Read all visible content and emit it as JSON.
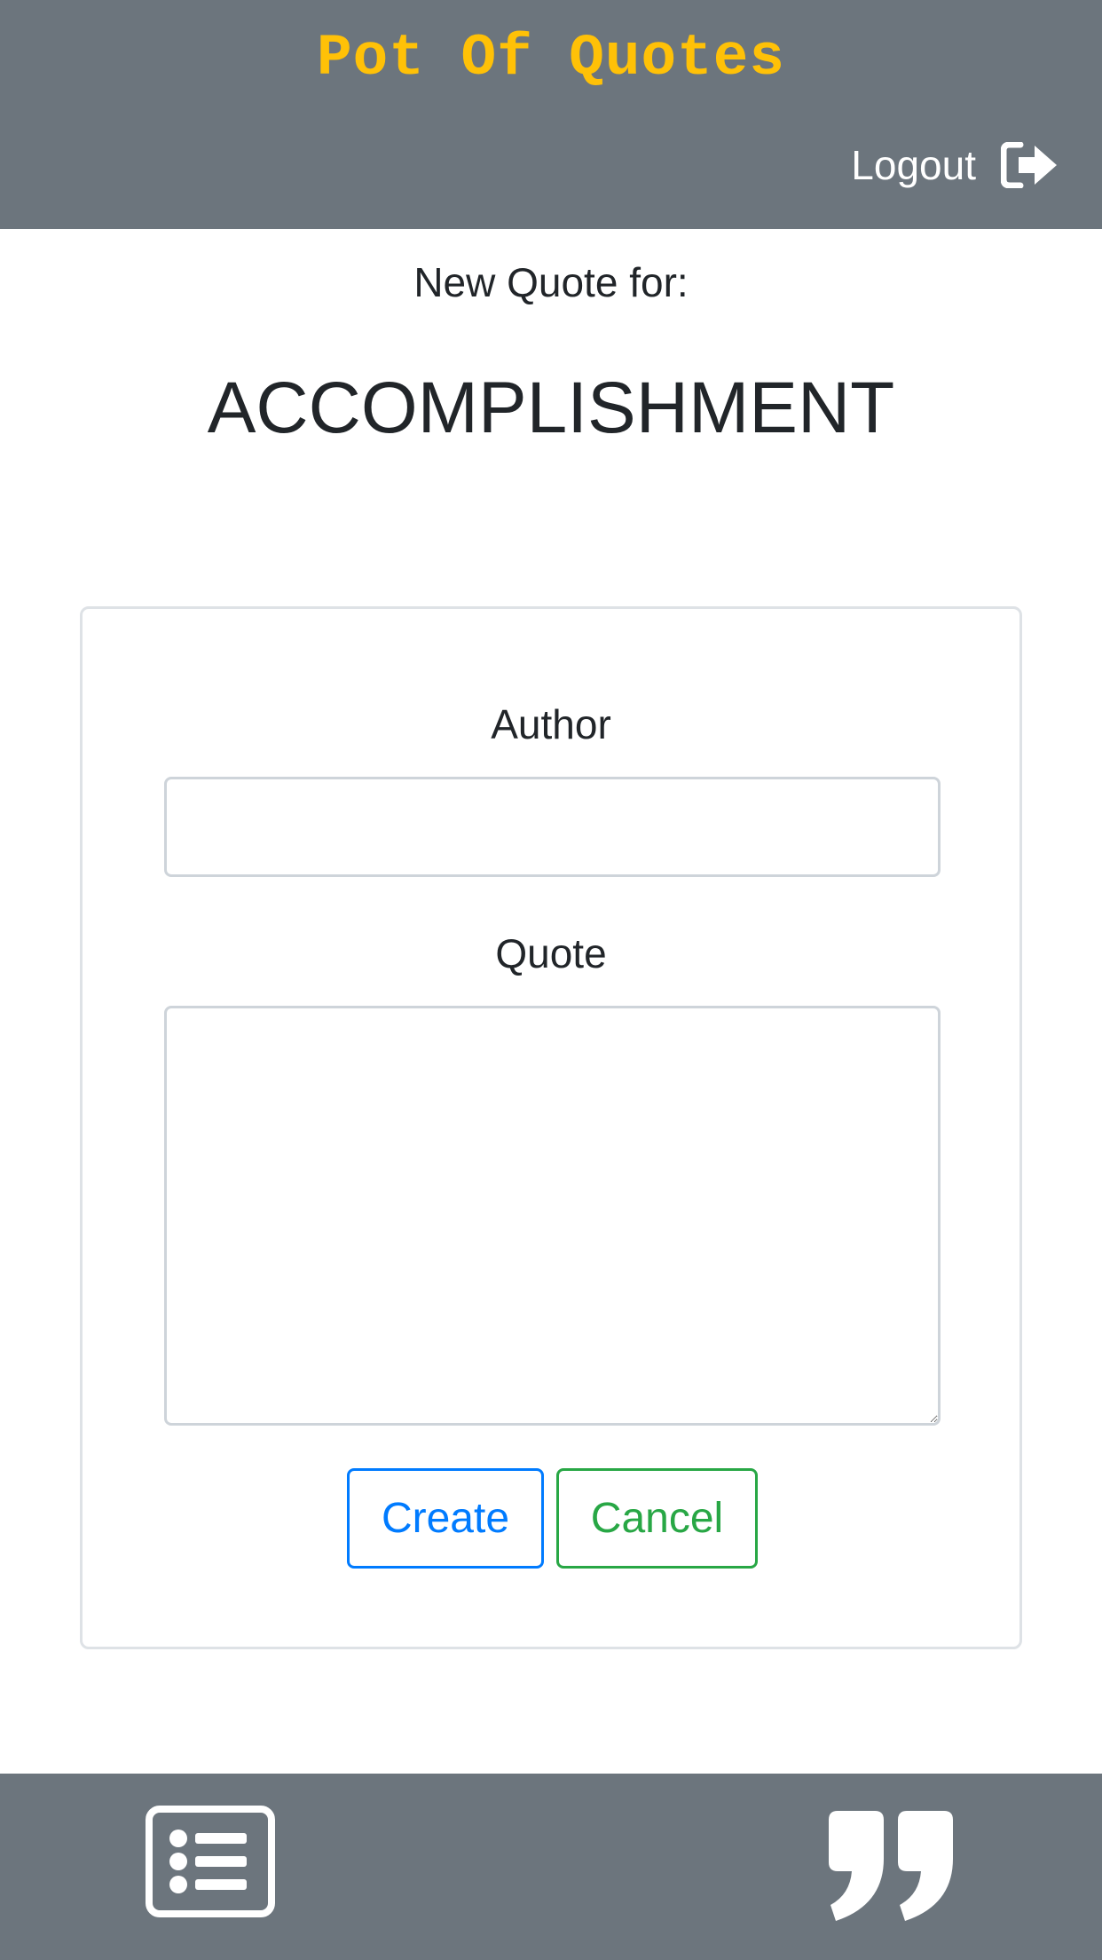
{
  "app": {
    "brand": "Pot Of Quotes",
    "colors": {
      "header_bg": "#6c757d",
      "brand": "#ffc107",
      "primary": "#007bff",
      "success": "#28a745"
    }
  },
  "header": {
    "logout_label": "Logout",
    "logout_icon": "sign-out-icon"
  },
  "page": {
    "subtitle": "New Quote for:",
    "category": "ACCOMPLISHMENT"
  },
  "form": {
    "author_label": "Author",
    "author_value": "",
    "author_placeholder": "",
    "quote_label": "Quote",
    "quote_value": "",
    "quote_placeholder": "",
    "create_label": "Create",
    "cancel_label": "Cancel"
  },
  "footer": {
    "left_icon": "list-icon",
    "right_icon": "quote-right-icon"
  }
}
